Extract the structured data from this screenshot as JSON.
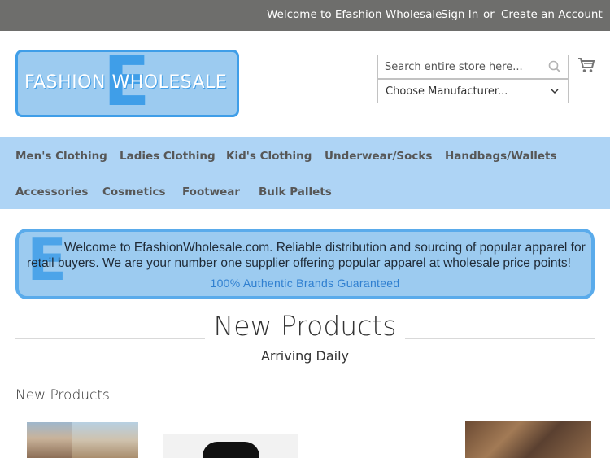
{
  "topbar": {
    "welcome": "Welcome to Efashion Wholesale",
    "sign_in": "Sign In",
    "or": "or",
    "create_account": "Create an Account"
  },
  "logo": {
    "big_letter": "E",
    "text": "FASHION WHOLESALE"
  },
  "search": {
    "placeholder": "Search entire store here...",
    "icon": "search-icon"
  },
  "manufacturer": {
    "selected": "Choose Manufacturer..."
  },
  "cart": {
    "icon": "cart-icon"
  },
  "nav": {
    "items": [
      {
        "label": "Men's Clothing"
      },
      {
        "label": "Ladies Clothing"
      },
      {
        "label": "Kid's Clothing"
      },
      {
        "label": "Underwear/Socks"
      },
      {
        "label": "Handbags/Wallets"
      },
      {
        "label": "Accessories"
      },
      {
        "label": "Cosmetics"
      },
      {
        "label": "Footwear"
      },
      {
        "label": "Bulk Pallets"
      }
    ]
  },
  "banner": {
    "big_letter": "E",
    "line1": "Welcome to EfashionWholesale.com. Reliable distribution and sourcing of popular apparel for",
    "line2": "retail buyers. We are your number one supplier offering popular apparel at wholesale price points!",
    "line3": "100% Authentic Brands Guaranteed"
  },
  "main": {
    "title": "New Products",
    "subtitle": "Arriving Daily",
    "section_title": "New Products"
  },
  "colors": {
    "topbar": "#6e6e6c",
    "nav": "#aed4f5",
    "accent": "#3f9ee8"
  }
}
